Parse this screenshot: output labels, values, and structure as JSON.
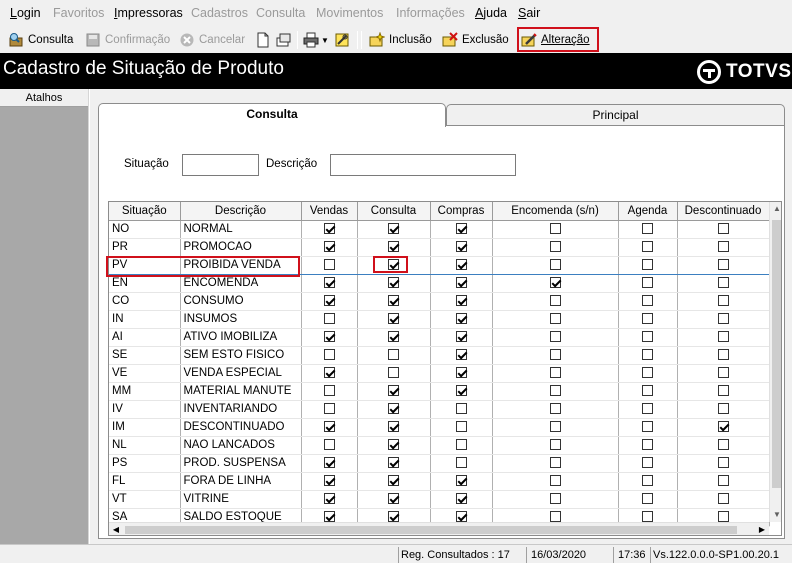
{
  "menu": [
    {
      "label": "Login",
      "enabled": true,
      "u": 0
    },
    {
      "label": "Favoritos",
      "enabled": false
    },
    {
      "label": "Impressoras",
      "enabled": true,
      "u": 0
    },
    {
      "label": "Cadastros",
      "enabled": false
    },
    {
      "label": "Consulta",
      "enabled": false
    },
    {
      "label": "Movimentos",
      "enabled": false
    },
    {
      "label": "Informações",
      "enabled": false
    },
    {
      "label": "Ajuda",
      "enabled": true,
      "u": 0
    },
    {
      "label": "Sair",
      "enabled": true,
      "u": 0
    }
  ],
  "toolbar": {
    "consulta": "Consulta",
    "confirmacao": "Confirmação",
    "cancelar": "Cancelar",
    "inclusao": "Inclusão",
    "exclusao": "Exclusão",
    "alteracao": "Alteração"
  },
  "window": {
    "title": "Cadastro de Situação de Produto",
    "logo_text": "TOTVS"
  },
  "sidebar": {
    "atalhos": "Atalhos"
  },
  "tabs": {
    "consulta": "Consulta",
    "principal": "Principal"
  },
  "filter": {
    "situacao_label": "Situação",
    "situacao_value": "",
    "descricao_label": "Descrição",
    "descricao_value": ""
  },
  "grid": {
    "columns": [
      "Situação",
      "Descrição",
      "Vendas",
      "Consulta",
      "Compras",
      "Encomenda (s/n)",
      "Agenda",
      "Descontinuado"
    ],
    "rows": [
      {
        "code": "NO",
        "desc": "NORMAL",
        "flags": [
          1,
          1,
          1,
          0,
          0,
          0
        ]
      },
      {
        "code": "PR",
        "desc": "PROMOCAO",
        "flags": [
          1,
          1,
          1,
          0,
          0,
          0
        ]
      },
      {
        "code": "PV",
        "desc": "PROIBIDA VENDA",
        "flags": [
          0,
          1,
          1,
          0,
          0,
          0
        ],
        "selected": true
      },
      {
        "code": "EN",
        "desc": "ENCOMENDA",
        "flags": [
          1,
          1,
          1,
          1,
          0,
          0
        ]
      },
      {
        "code": "CO",
        "desc": "CONSUMO",
        "flags": [
          1,
          1,
          1,
          0,
          0,
          0
        ]
      },
      {
        "code": "IN",
        "desc": "INSUMOS",
        "flags": [
          0,
          1,
          1,
          0,
          0,
          0
        ]
      },
      {
        "code": "AI",
        "desc": "ATIVO IMOBILIZA",
        "flags": [
          1,
          1,
          1,
          0,
          0,
          0
        ]
      },
      {
        "code": "SE",
        "desc": "SEM ESTO FISICO",
        "flags": [
          0,
          0,
          1,
          0,
          0,
          0
        ]
      },
      {
        "code": "VE",
        "desc": "VENDA ESPECIAL",
        "flags": [
          1,
          0,
          1,
          0,
          0,
          0
        ]
      },
      {
        "code": "MM",
        "desc": "MATERIAL MANUTE",
        "flags": [
          0,
          1,
          1,
          0,
          0,
          0
        ]
      },
      {
        "code": "IV",
        "desc": "INVENTARIANDO",
        "flags": [
          0,
          1,
          0,
          0,
          0,
          0
        ]
      },
      {
        "code": "IM",
        "desc": "DESCONTINUADO",
        "flags": [
          1,
          1,
          0,
          0,
          0,
          1
        ]
      },
      {
        "code": "NL",
        "desc": "NAO LANCADOS",
        "flags": [
          0,
          1,
          0,
          0,
          0,
          0
        ]
      },
      {
        "code": "PS",
        "desc": "PROD. SUSPENSA",
        "flags": [
          1,
          1,
          0,
          0,
          0,
          0
        ]
      },
      {
        "code": "FL",
        "desc": "FORA DE LINHA",
        "flags": [
          1,
          1,
          1,
          0,
          0,
          0
        ]
      },
      {
        "code": "VT",
        "desc": "VITRINE",
        "flags": [
          1,
          1,
          1,
          0,
          0,
          0
        ]
      },
      {
        "code": "SA",
        "desc": "SALDO ESTOQUE",
        "flags": [
          1,
          1,
          1,
          0,
          0,
          0
        ]
      }
    ]
  },
  "status": {
    "records": "Reg. Consultados : 17",
    "date": "16/03/2020",
    "time": "17:36",
    "version": "Vs.122.0.0.0-SP1.00.20.1"
  },
  "colors": {
    "highlight": "#d0101b",
    "selection": "#3b7fc0",
    "title_bg": "#000000"
  }
}
